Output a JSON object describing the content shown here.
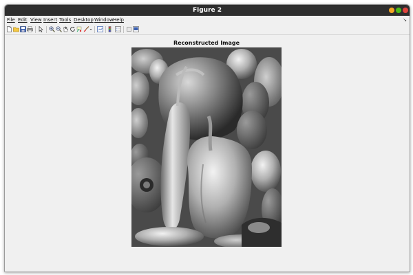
{
  "window": {
    "title": "Figure 2",
    "controls": [
      {
        "name": "minimize",
        "color": "#f5a623"
      },
      {
        "name": "maximize",
        "color": "#4cbb17"
      },
      {
        "name": "close",
        "color": "#e0443e"
      }
    ]
  },
  "menubar": {
    "items": [
      "File",
      "Edit",
      "View",
      "Insert",
      "Tools",
      "Desktop",
      "Window",
      "Help"
    ],
    "dock_glyph": "↘"
  },
  "toolbar": {
    "icons": [
      "new-figure-icon",
      "open-file-icon",
      "save-icon",
      "print-icon",
      "edit-plot-icon",
      "zoom-in-icon",
      "zoom-out-icon",
      "pan-icon",
      "rotate-3d-icon",
      "data-cursor-icon",
      "brush-icon",
      "brush-dropdown-icon",
      "link-plot-icon",
      "insert-colorbar-icon",
      "insert-legend-icon",
      "hide-plot-tools-icon",
      "show-plot-tools-icon"
    ]
  },
  "axes": {
    "title": "Reconstructed Image"
  }
}
